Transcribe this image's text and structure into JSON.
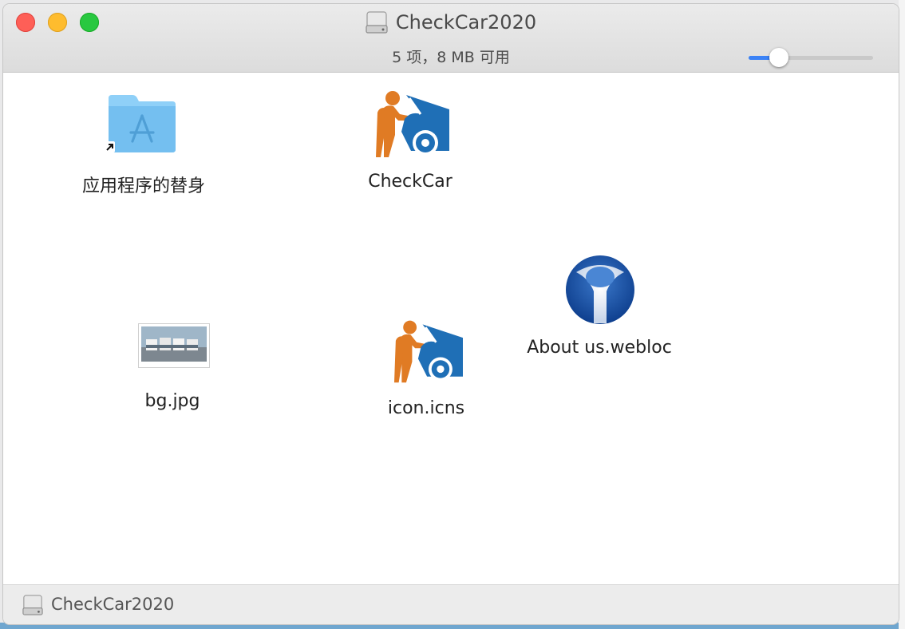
{
  "window": {
    "title": "CheckCar2020",
    "status": "5 项，8 MB 可用",
    "path_label": "CheckCar2020",
    "icon_size_slider": 0.2
  },
  "items": [
    {
      "name": "applications-alias",
      "label": "应用程序的替身",
      "icon": "app-folder-alias-icon"
    },
    {
      "name": "checkcar-app",
      "label": "CheckCar",
      "icon": "checkcar-app-icon"
    },
    {
      "name": "bg-jpg",
      "label": "bg.jpg",
      "icon": "image-thumbnail-icon"
    },
    {
      "name": "icon-icns",
      "label": "icon.icns",
      "icon": "checkcar-icns-icon"
    },
    {
      "name": "about-us-webloc",
      "label": "About us.webloc",
      "icon": "webloc-globe-icon"
    }
  ],
  "colors": {
    "close": "#fe5f57",
    "minimize": "#febc2e",
    "maximize": "#28c840",
    "accent": "#3b82f6",
    "folder": "#7cc4f4",
    "person_orange": "#e07b24",
    "car_blue": "#1f6fb6"
  }
}
